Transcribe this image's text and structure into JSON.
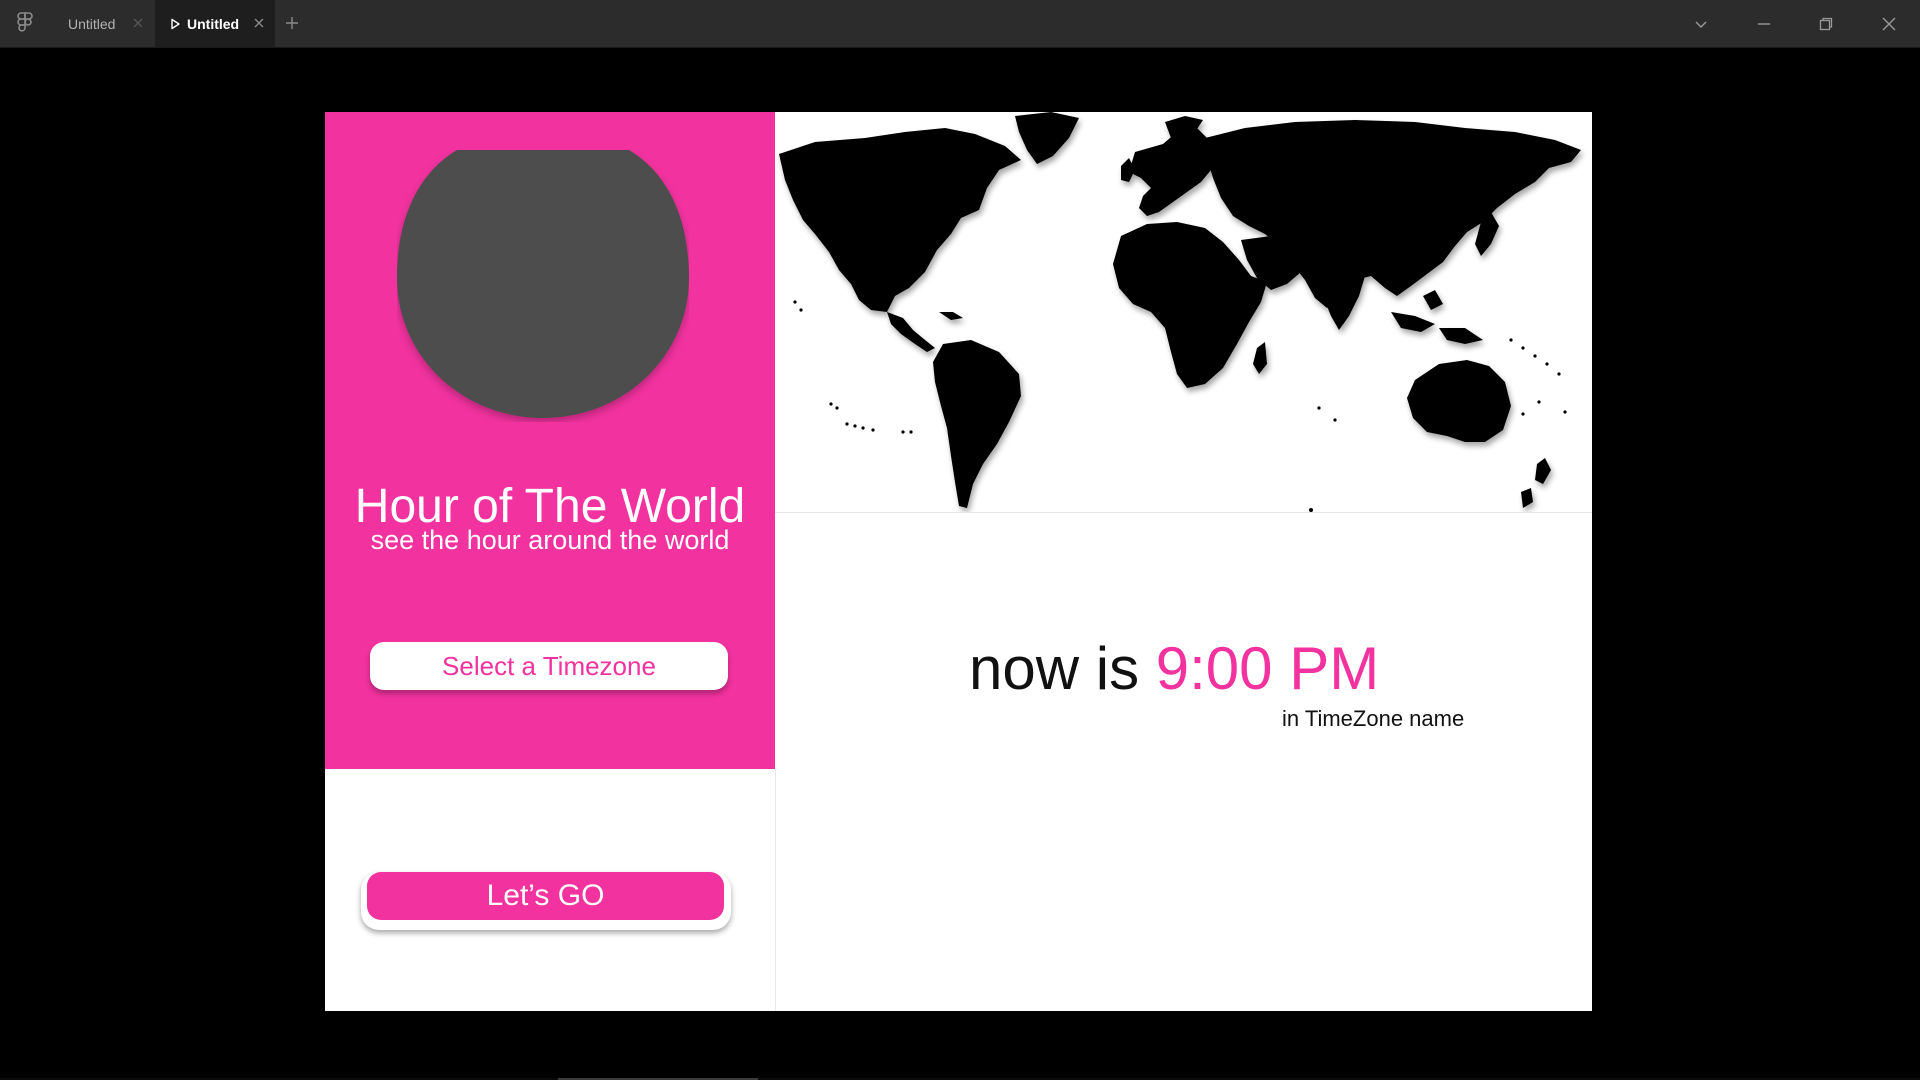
{
  "window": {
    "tabs": [
      {
        "label": "Untitled",
        "active": false
      },
      {
        "label": "Untitled",
        "active": true
      }
    ],
    "icons": {
      "logo": "figma-logo-icon",
      "new_tab": "plus-icon",
      "dropdown": "chevron-down-icon",
      "minimize": "minimize-icon",
      "maximize": "restore-icon",
      "close": "close-icon"
    }
  },
  "app": {
    "title": "Hour of The World",
    "subtitle": "see the hour around the world",
    "select_button": "Select a Timezone",
    "go_button": "Let’s GO",
    "now_label": "now is",
    "time_value": "9:00 PM",
    "timezone_label": "in TimeZone name"
  },
  "colors": {
    "accent": "#f2329f",
    "globe": "#4d4d4d",
    "background": "#000000",
    "titlebar": "#2c2c2c",
    "map_land": "#000000",
    "panel_white": "#ffffff"
  }
}
